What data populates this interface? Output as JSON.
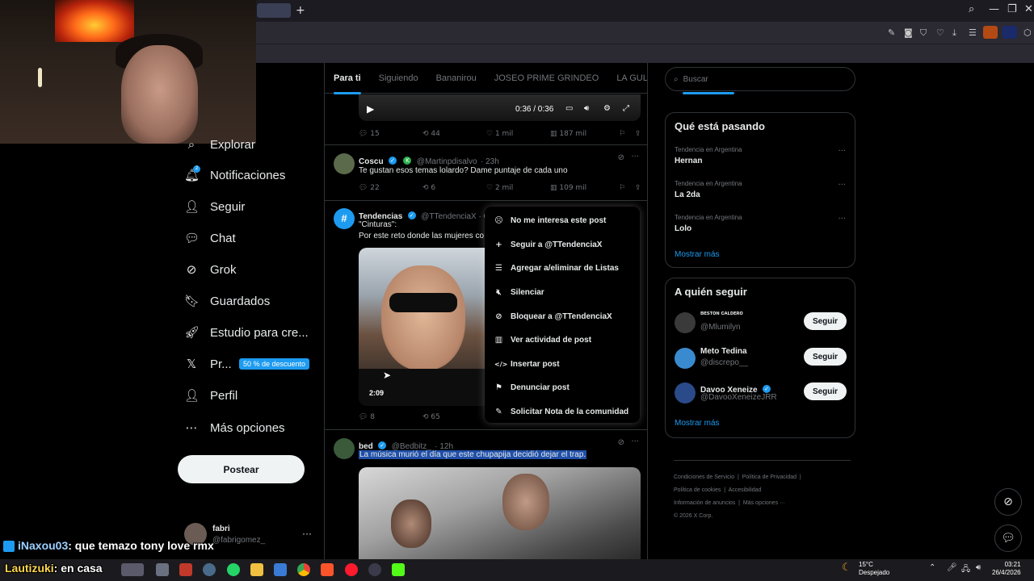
{
  "browser": {
    "new_tab": "+",
    "win_min": "—",
    "win_restore": "❐",
    "win_close": "✕"
  },
  "sidebar": {
    "items": [
      {
        "icon": "⌕",
        "label": "Explorar"
      },
      {
        "icon": "🔔︎",
        "label": "Notificaciones"
      },
      {
        "icon": "👤︎",
        "label": "Seguir"
      },
      {
        "icon": "💬︎",
        "label": "Chat"
      },
      {
        "icon": "⊘",
        "label": "Grok"
      },
      {
        "icon": "🔖︎",
        "label": "Guardados"
      },
      {
        "icon": "🚀︎",
        "label": "Estudio para cre..."
      },
      {
        "icon": "𝕏",
        "label": "Pr..."
      },
      {
        "icon": "👤︎",
        "label": "Perfil"
      },
      {
        "icon": "⋯",
        "label": "Más opciones"
      }
    ],
    "promo_badge": "50 % de descuento",
    "post_button": "Postear",
    "notification_count": "2",
    "account": {
      "name": "fabri",
      "handle": "@fabrigomez_"
    }
  },
  "timeline": {
    "tabs": [
      "Para ti",
      "Siguiendo",
      "Bananirou",
      "JOSEO PRIME GRINDEO",
      "LA GULA"
    ],
    "video_player": {
      "time": "0:36 / 0:36"
    },
    "tweet0_actions": {
      "replies": "15",
      "retweets": "44",
      "likes": "1 mil",
      "views": "187 mil"
    },
    "tweets": [
      {
        "name": "Coscu",
        "handle": "@Martinpdisalvo",
        "time": "· 23h",
        "text": "Te gustan esos temas lolardo? Dame puntaje de cada uno",
        "replies": "22",
        "retweets": "6",
        "likes": "2 mil",
        "views": "109 mil"
      },
      {
        "name": "Tendencias",
        "handle": "@TTendenciaX · 6h",
        "text_line1": "\"Cinturas\":",
        "text_line2": "Por este reto donde las mujeres co",
        "video_duration": "2:09",
        "replies": "8",
        "retweets": "65"
      },
      {
        "name": "bed",
        "handle": "@Bedbitz_",
        "time": "· 12h",
        "text": "La música murió el día que este chupapija decidió dejar el trap."
      }
    ]
  },
  "context_menu": [
    {
      "icon": "☹",
      "label": "No me interesa este post"
    },
    {
      "icon": "+",
      "label": "Seguir a @TTendenciaX"
    },
    {
      "icon": "☰",
      "label": "Agregar a/eliminar de Listas"
    },
    {
      "icon": "🔇︎",
      "label": "Silenciar"
    },
    {
      "icon": "⊘",
      "label": "Bloquear a @TTendenciaX"
    },
    {
      "icon": "▥",
      "label": "Ver actividad de post"
    },
    {
      "icon": "</>",
      "label": "Insertar post"
    },
    {
      "icon": "⚑",
      "label": "Denunciar post"
    },
    {
      "icon": "✎",
      "label": "Solicitar Nota de la comunidad"
    }
  ],
  "search": {
    "placeholder": "Buscar"
  },
  "trends": {
    "title": "Qué está pasando",
    "items": [
      {
        "category": "Tendencia en Argentina",
        "name": "Hernan"
      },
      {
        "category": "Tendencia en Argentina",
        "name": "La 2da"
      },
      {
        "category": "Tendencia en Argentina",
        "name": "Lolo"
      }
    ],
    "show_more": "Mostrar más"
  },
  "who_to_follow": {
    "title": "A quién seguir",
    "items": [
      {
        "name": "ʙᴇsᴛᴏɴ ᴄᴀʟᴅᴇʀᴏ",
        "handle": "@Mlumilyn",
        "button": "Seguir"
      },
      {
        "name": "Meto Tedina",
        "handle": "@discrepo__",
        "button": "Seguir"
      },
      {
        "name": "Davoo Xeneize",
        "handle": "@DavooXeneizeJRR",
        "button": "Seguir"
      }
    ],
    "show_more": "Mostrar más"
  },
  "footer": {
    "links": [
      "Condiciones de Servicio",
      "Política de Privacidad",
      "Política de cookies",
      "Accesibilidad",
      "Información de anuncios",
      "Más opciones ···"
    ],
    "copyright": "© 2026 X Corp."
  },
  "chat_overlay": [
    {
      "user": "iNaxou03",
      "message": ": que temazo tony love rmx"
    },
    {
      "user": "Lautizuki",
      "message": ": en casa"
    }
  ],
  "taskbar": {
    "weather_temp": "15°C",
    "weather_desc": "Despejado",
    "time": "03:21",
    "date": "26/4/2026"
  },
  "colors": {
    "accent": "#1d9bf0",
    "background": "#000000",
    "border": "#2f3336",
    "muted": "#71767b"
  }
}
